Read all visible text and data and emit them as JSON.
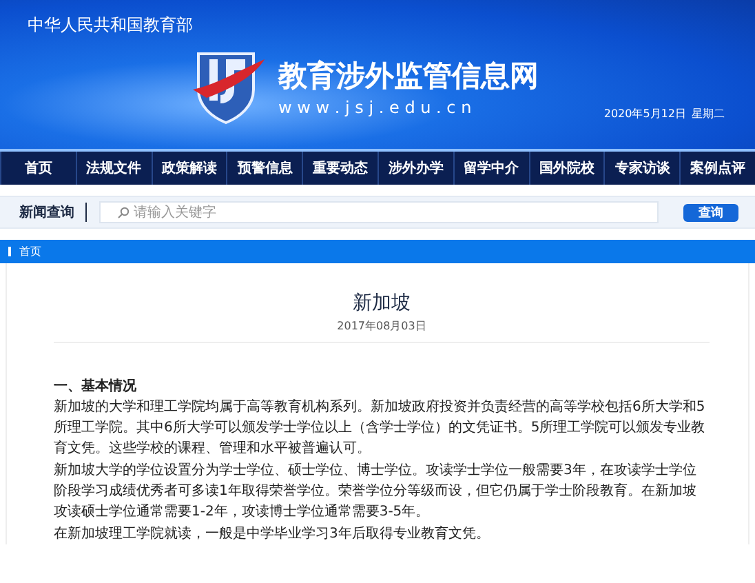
{
  "header": {
    "ministry": "中华人民共和国教育部",
    "site_name": "教育涉外监管信息网",
    "url": "w w w . j s j . e d u . c n",
    "date": "2020年5月12日",
    "weekday": "星期二"
  },
  "nav": [
    "首页",
    "法规文件",
    "政策解读",
    "预警信息",
    "重要动态",
    "涉外办学",
    "留学中介",
    "国外院校",
    "专家访谈",
    "案例点评"
  ],
  "search": {
    "label": "新闻查询",
    "placeholder": "请输入关键字",
    "button": "查询"
  },
  "breadcrumb": "首页",
  "article": {
    "title": "新加坡",
    "date": "2017年08月03日",
    "heading": "一、基本情况",
    "paragraphs": [
      "新加坡的大学和理工学院均属于高等教育机构系列。新加坡政府投资并负责经营的高等学校包括6所大学和5所理工学院。其中6所大学可以颁发学士学位以上（含学士学位）的文凭证书。5所理工学院可以颁发专业教育文凭。这些学校的课程、管理和水平被普遍认可。",
      "新加坡大学的学位设置分为学士学位、硕士学位、博士学位。攻读学士学位一般需要3年，在攻读学士学位阶段学习成绩优秀者可多读1年取得荣誉学位。荣誉学位分等级而设，但它仍属于学士阶段教育。在新加坡攻读硕士学位通常需要1-2年，攻读博士学位通常需要3-5年。",
      "在新加坡理工学院就读，一般是中学毕业学习3年后取得专业教育文凭。"
    ]
  }
}
